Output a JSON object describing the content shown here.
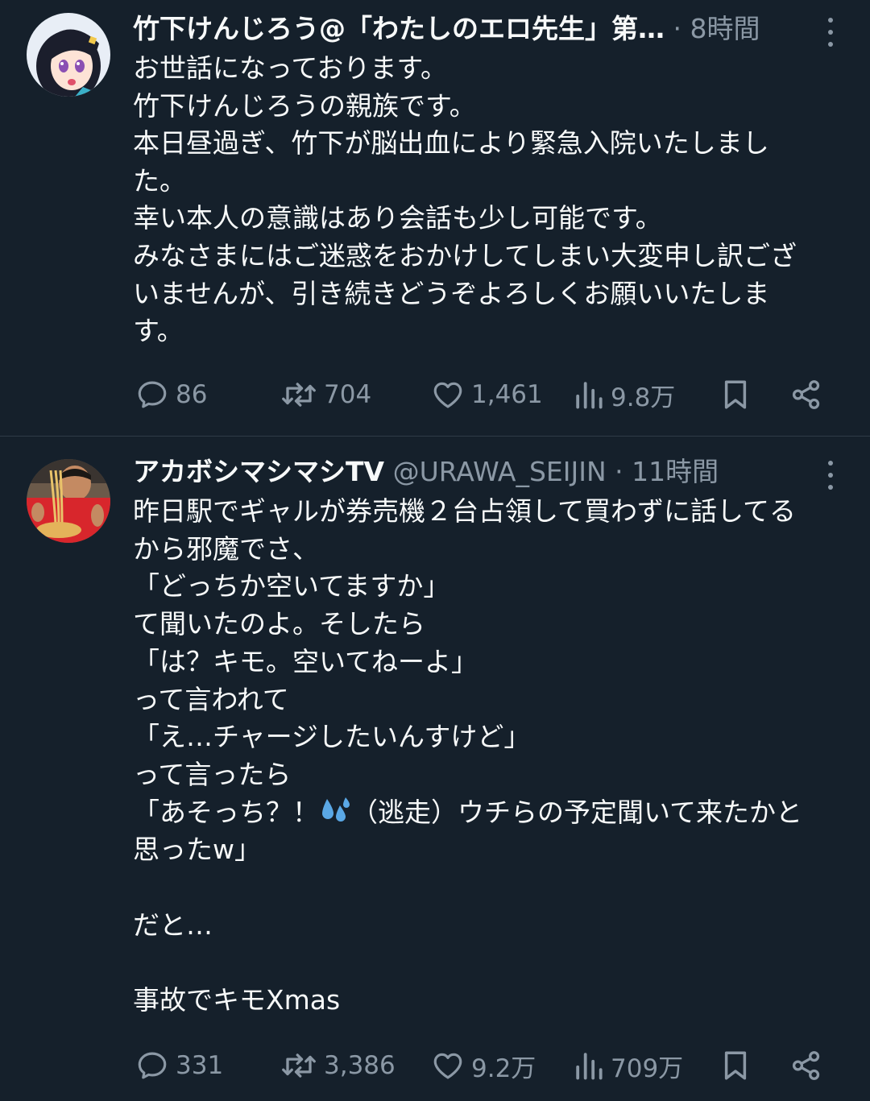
{
  "colors": {
    "background": "#15202b",
    "text": "#f7f9f9",
    "muted": "#8b98a5",
    "divider": "#2f3b47"
  },
  "tweets": [
    {
      "author": "竹下けんじろう@「わたしのエロ先生」第…",
      "handle": "",
      "time": "8時間",
      "avatar_icon": "anime-girl-avatar",
      "body": "お世話になっております。\n竹下けんじろうの親族です。\n本日昼過ぎ、竹下が脳出血により緊急入院いたしまし\nた。\n幸い本人の意識はあり会話も少し可能です。\nみなさまにはご迷惑をおかけしてしまい大変申し訳ござ\nいませんが、引き続きどうぞよろしくお願いいたしま\nす。",
      "replies": "86",
      "reposts": "704",
      "likes": "1,461",
      "views": "9.8万"
    },
    {
      "author": "アカボシマシマシTV",
      "handle": "@URAWA_SEIJIN",
      "time": "11時間",
      "avatar_icon": "ramen-person-avatar",
      "body_part1": "昨日駅でギャルが券売機２台占領して買わずに話してる\nから邪魔でさ、\n「どっちか空いてますか」\nて聞いたのよ。そしたら\n「は？キモ。空いてねーよ」\nって言われて\n「え…チャージしたいんすけど」\nって言ったら\n「あそっち？！",
      "body_part2": "（逃走）ウチらの予定聞いて来たかと\n思ったw」\n\nだと…\n\n事故でキモXmas",
      "replies": "331",
      "reposts": "3,386",
      "likes": "9.2万",
      "views": "709万"
    }
  ]
}
